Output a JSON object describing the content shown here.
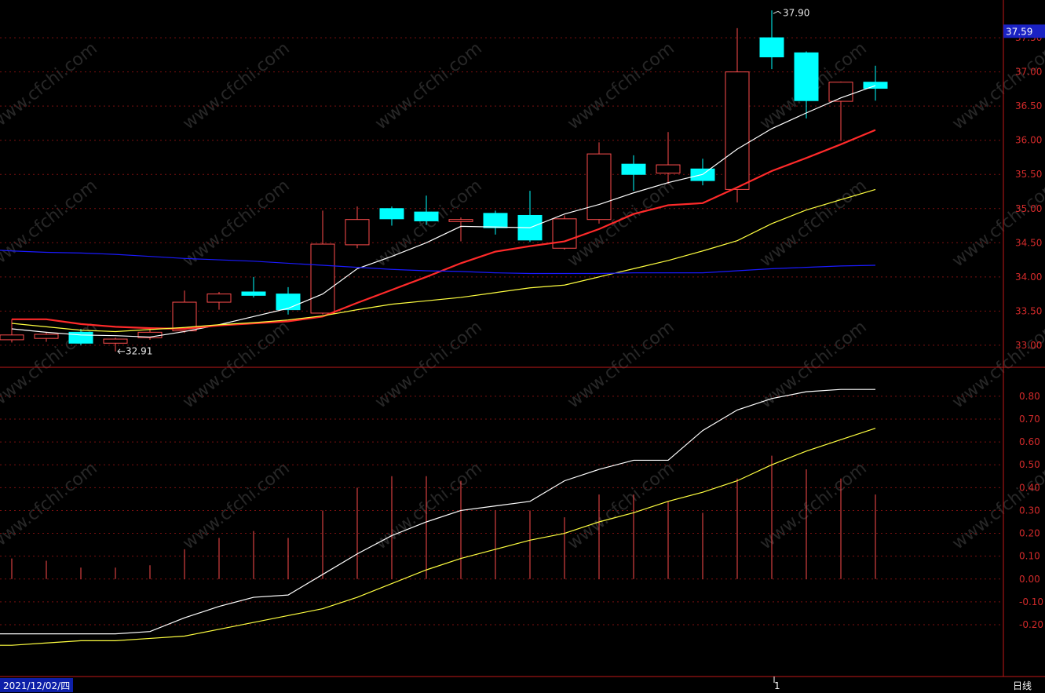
{
  "chart_data": [
    {
      "type": "candlestick",
      "panel": "price",
      "ylim": [
        32.7,
        37.8
      ],
      "y_ticks": [
        "37.50",
        "37.00",
        "36.50",
        "36.00",
        "35.50",
        "35.00",
        "34.50",
        "34.00",
        "33.50",
        "33.00"
      ],
      "current_price_label": "37.59",
      "current_price": 37.59,
      "high_annotation": "37.90",
      "low_annotation": "32.91",
      "candles": [
        {
          "o": 33.08,
          "c": 33.15,
          "h": 33.38,
          "l": 33.04
        },
        {
          "o": 33.1,
          "c": 33.16,
          "h": 33.19,
          "l": 33.05
        },
        {
          "o": 33.19,
          "c": 33.03,
          "h": 33.24,
          "l": 33.0
        },
        {
          "o": 33.03,
          "c": 33.09,
          "h": 33.11,
          "l": 32.91
        },
        {
          "o": 33.11,
          "c": 33.19,
          "h": 33.24,
          "l": 33.08
        },
        {
          "o": 33.21,
          "c": 33.63,
          "h": 33.8,
          "l": 33.18
        },
        {
          "o": 33.63,
          "c": 33.75,
          "h": 33.78,
          "l": 33.52
        },
        {
          "o": 33.78,
          "c": 33.73,
          "h": 34.0,
          "l": 33.7
        },
        {
          "o": 33.75,
          "c": 33.52,
          "h": 33.85,
          "l": 33.45
        },
        {
          "o": 33.47,
          "c": 34.48,
          "h": 34.97,
          "l": 33.45
        },
        {
          "o": 34.47,
          "c": 34.84,
          "h": 35.03,
          "l": 34.42
        },
        {
          "o": 35.0,
          "c": 34.85,
          "h": 35.03,
          "l": 34.75
        },
        {
          "o": 34.95,
          "c": 34.82,
          "h": 35.19,
          "l": 34.76
        },
        {
          "o": 34.81,
          "c": 34.84,
          "h": 34.87,
          "l": 34.52
        },
        {
          "o": 34.93,
          "c": 34.72,
          "h": 34.97,
          "l": 34.62
        },
        {
          "o": 34.9,
          "c": 34.54,
          "h": 35.26,
          "l": 34.51
        },
        {
          "o": 34.42,
          "c": 34.85,
          "h": 34.9,
          "l": 34.4
        },
        {
          "o": 34.84,
          "c": 35.8,
          "h": 35.97,
          "l": 34.78
        },
        {
          "o": 35.65,
          "c": 35.5,
          "h": 35.78,
          "l": 35.26
        },
        {
          "o": 35.52,
          "c": 35.64,
          "h": 36.12,
          "l": 35.36
        },
        {
          "o": 35.58,
          "c": 35.41,
          "h": 35.73,
          "l": 35.34
        },
        {
          "o": 35.28,
          "c": 37.0,
          "h": 37.64,
          "l": 35.09
        },
        {
          "o": 37.5,
          "c": 37.22,
          "h": 37.9,
          "l": 37.04
        },
        {
          "o": 37.28,
          "c": 36.58,
          "h": 37.3,
          "l": 36.32
        },
        {
          "o": 36.57,
          "c": 36.85,
          "h": 36.86,
          "l": 35.99
        },
        {
          "o": 36.85,
          "c": 36.76,
          "h": 37.09,
          "l": 36.58
        }
      ],
      "series": [
        {
          "color": "#ffffff",
          "width": 1.2,
          "values": [
            33.24,
            33.19,
            33.15,
            33.14,
            33.12,
            33.2,
            33.3,
            33.42,
            33.54,
            33.75,
            34.12,
            34.3,
            34.5,
            34.74,
            34.73,
            34.72,
            34.92,
            35.06,
            35.23,
            35.38,
            35.5,
            35.87,
            36.17,
            36.4,
            36.62,
            36.8
          ]
        },
        {
          "color": "#ff2a2a",
          "width": 2.2,
          "values": [
            33.38,
            33.38,
            33.31,
            33.27,
            33.25,
            33.24,
            33.29,
            33.32,
            33.35,
            33.42,
            33.62,
            33.81,
            34.0,
            34.2,
            34.37,
            34.45,
            34.52,
            34.7,
            34.92,
            35.05,
            35.08,
            35.31,
            35.55,
            35.74,
            35.94,
            36.15
          ]
        },
        {
          "color": "#ffff40",
          "width": 1.2,
          "values": [
            33.32,
            33.27,
            33.22,
            33.2,
            33.23,
            33.26,
            33.3,
            33.33,
            33.37,
            33.43,
            33.52,
            33.6,
            33.65,
            33.7,
            33.77,
            33.84,
            33.88,
            34.0,
            34.12,
            34.24,
            34.38,
            34.53,
            34.78,
            34.98,
            35.13,
            35.28
          ]
        },
        {
          "color": "#1a1aff",
          "width": 1.2,
          "values": [
            34.38,
            34.36,
            34.35,
            34.33,
            34.3,
            34.27,
            34.25,
            34.23,
            34.2,
            34.17,
            34.14,
            34.11,
            34.09,
            34.08,
            34.06,
            34.05,
            34.05,
            34.05,
            34.06,
            34.06,
            34.06,
            34.09,
            34.12,
            34.14,
            34.16,
            34.17
          ]
        }
      ]
    },
    {
      "type": "bar+line",
      "panel": "indicator",
      "ylim": [
        -0.42,
        0.92
      ],
      "y_ticks": [
        "0.80",
        "0.70",
        "0.60",
        "0.50",
        "0.40",
        "0.30",
        "0.20",
        "0.10",
        "0.00",
        "-0.10",
        "-0.20"
      ],
      "bars": [
        0.09,
        0.08,
        0.05,
        0.05,
        0.06,
        0.13,
        0.18,
        0.21,
        0.18,
        0.3,
        0.4,
        0.45,
        0.45,
        0.43,
        0.3,
        0.3,
        0.27,
        0.37,
        0.37,
        0.34,
        0.29,
        0.44,
        0.54,
        0.48,
        0.44,
        0.37
      ],
      "series": [
        {
          "color": "#ffffff",
          "values": [
            -0.24,
            -0.24,
            -0.24,
            -0.24,
            -0.23,
            -0.17,
            -0.12,
            -0.08,
            -0.07,
            0.02,
            0.11,
            0.19,
            0.25,
            0.3,
            0.32,
            0.34,
            0.43,
            0.48,
            0.52,
            0.52,
            0.65,
            0.74,
            0.79,
            0.82,
            0.83,
            0.83
          ]
        },
        {
          "color": "#ffff40",
          "values": [
            -0.29,
            -0.28,
            -0.27,
            -0.27,
            -0.26,
            -0.25,
            -0.22,
            -0.19,
            -0.16,
            -0.13,
            -0.08,
            -0.02,
            0.04,
            0.09,
            0.13,
            0.17,
            0.2,
            0.25,
            0.29,
            0.34,
            0.38,
            0.43,
            0.5,
            0.56,
            0.61,
            0.66
          ]
        }
      ]
    }
  ],
  "footer": {
    "date_label": "2021/12/02/四",
    "period_label": "日线",
    "marker": "1"
  },
  "watermark": "www.cfchi.com",
  "colors": {
    "up": "#ff4d4d",
    "down": "#00ffff",
    "grid": "#7a1010",
    "axis": "#c01818",
    "current_price_bg": "#1a22c4"
  }
}
